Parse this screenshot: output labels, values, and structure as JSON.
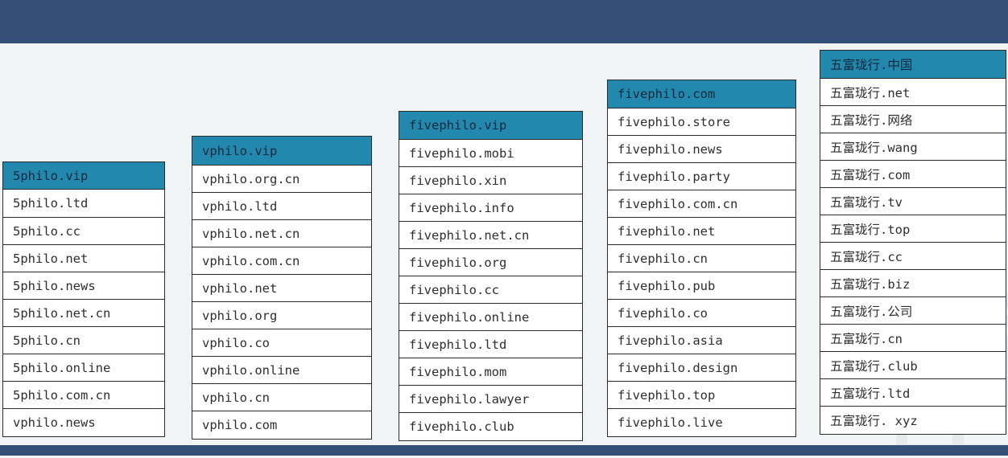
{
  "columns": [
    {
      "header": "5philo.vip",
      "items": [
        "5philo.ltd",
        "5philo.cc",
        "5philo.net",
        "5philo.news",
        "5philo.net.cn",
        "5philo.cn",
        "5philo.online",
        "5philo.com.cn",
        "vphilo.news"
      ]
    },
    {
      "header": "vphilo.vip",
      "items": [
        "vphilo.org.cn",
        "vphilo.ltd",
        "vphilo.net.cn",
        "vphilo.com.cn",
        "vphilo.net",
        "vphilo.org",
        "vphilo.co",
        "vphilo.online",
        "vphilo.cn",
        "vphilo.com"
      ]
    },
    {
      "header": "fivephilo.vip",
      "items": [
        "fivephilo.mobi",
        "fivephilo.xin",
        "fivephilo.info",
        "fivephilo.net.cn",
        "fivephilo.org",
        "fivephilo.cc",
        "fivephilo.online",
        "fivephilo.ltd",
        "fivephilo.mom",
        "fivephilo.lawyer",
        "fivephilo.club"
      ]
    },
    {
      "header": "fivephilo.com",
      "items": [
        "fivephilo.store",
        "fivephilo.news",
        "fivephilo.party",
        "fivephilo.com.cn",
        "fivephilo.net",
        "fivephilo.cn",
        "fivephilo.pub",
        "fivephilo.co",
        "fivephilo.asia",
        "fivephilo.design",
        "fivephilo.top",
        "fivephilo.live"
      ]
    },
    {
      "header": "五富珑行.中国",
      "items": [
        "五富珑行.net",
        "五富珑行.网络",
        "五富珑行.wang",
        "五富珑行.com",
        "五富珑行.tv",
        "五富珑行.top",
        "五富珑行.cc",
        "五富珑行.biz",
        "五富珑行.公司",
        "五富珑行.cn",
        "五富珑行.club",
        "五富珑行.ltd",
        "五富珑行. xyz"
      ]
    }
  ],
  "colors": {
    "banner": "#344f78",
    "header_cell": "#2388ae",
    "background": "#f1f4f5"
  }
}
